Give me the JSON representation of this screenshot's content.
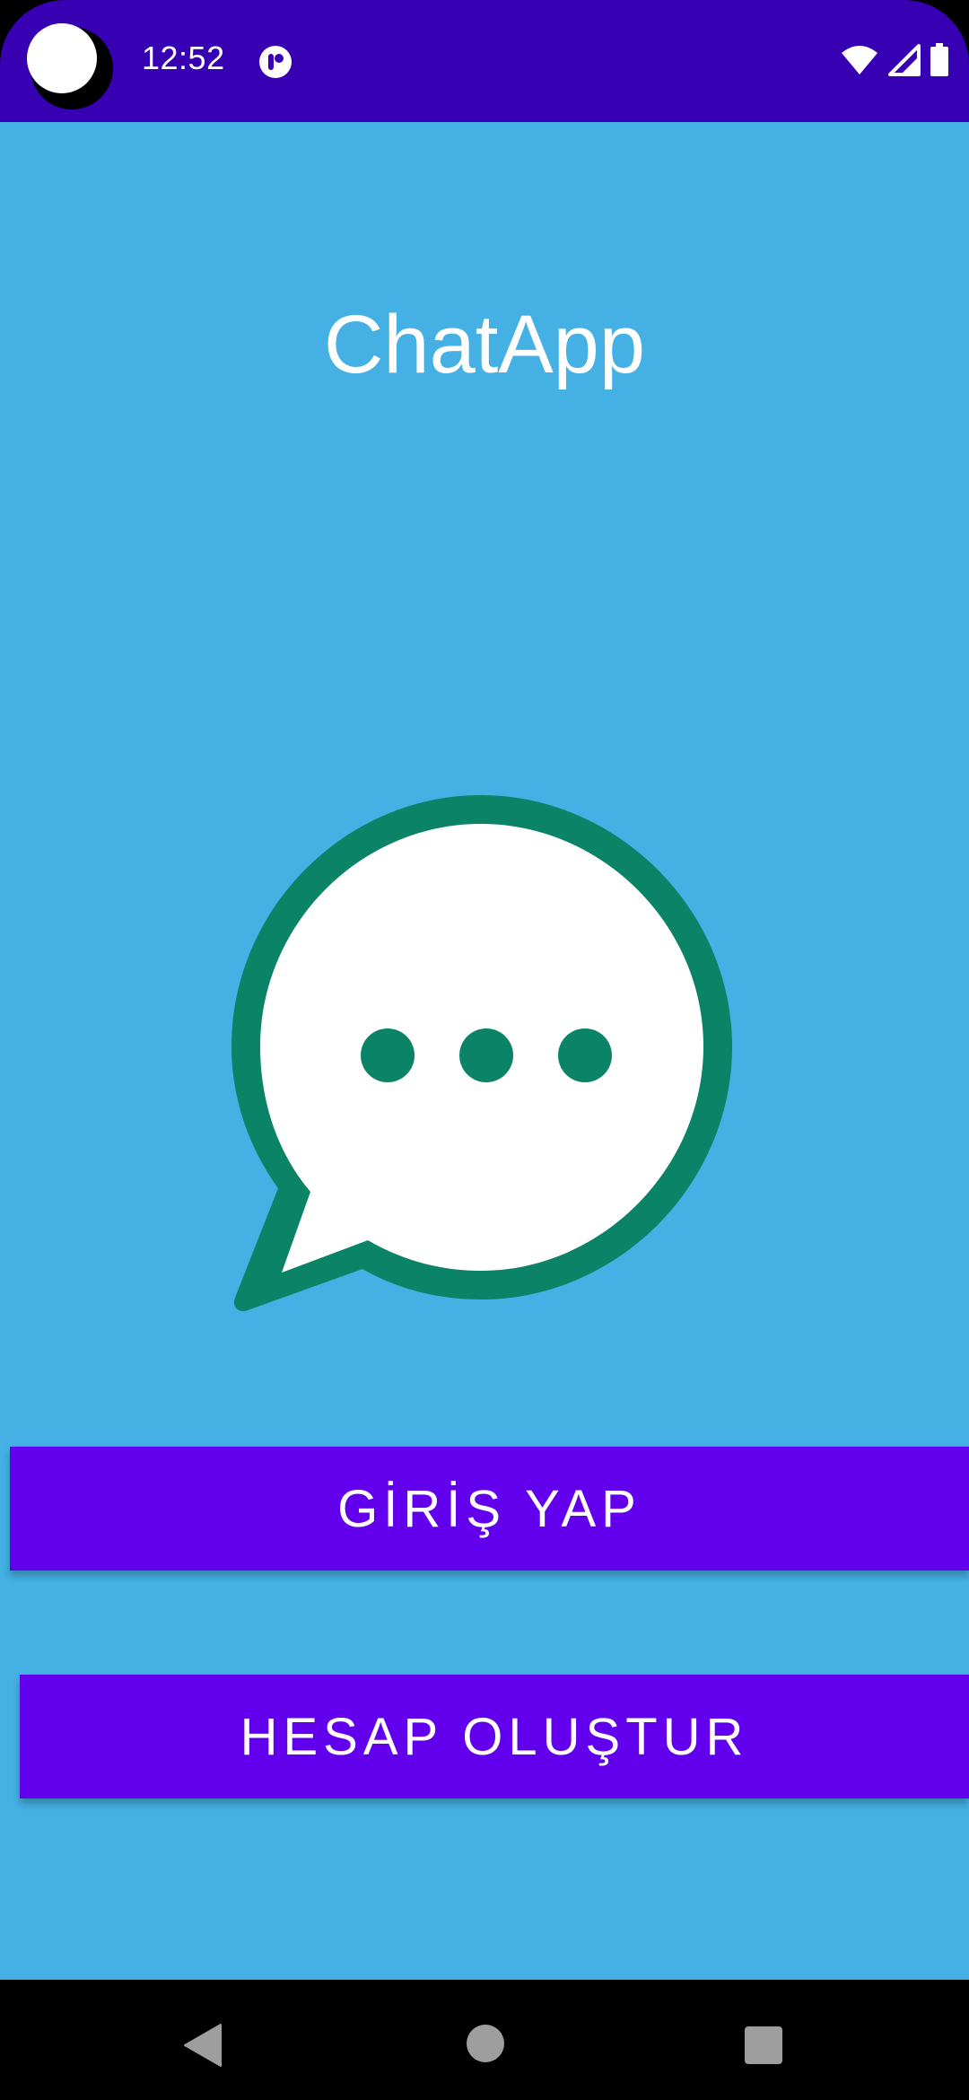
{
  "status_bar": {
    "time": "12:52",
    "background": "#3700B3",
    "icons": [
      "notification-icon",
      "wifi-icon",
      "cellular-icon",
      "battery-icon"
    ]
  },
  "app": {
    "title": "ChatApp",
    "background": "#44B0E3",
    "logo_icon": "chat-bubble-icon",
    "logo_colors": {
      "ring": "#0A8366",
      "fill": "#FFFFFF"
    }
  },
  "buttons": {
    "login_label": "GİRİŞ YAP",
    "register_label": "HESAP OLUŞTUR",
    "color": "#6200EE"
  },
  "nav_bar": {
    "icons": [
      "back-icon",
      "home-icon",
      "recents-icon"
    ]
  }
}
